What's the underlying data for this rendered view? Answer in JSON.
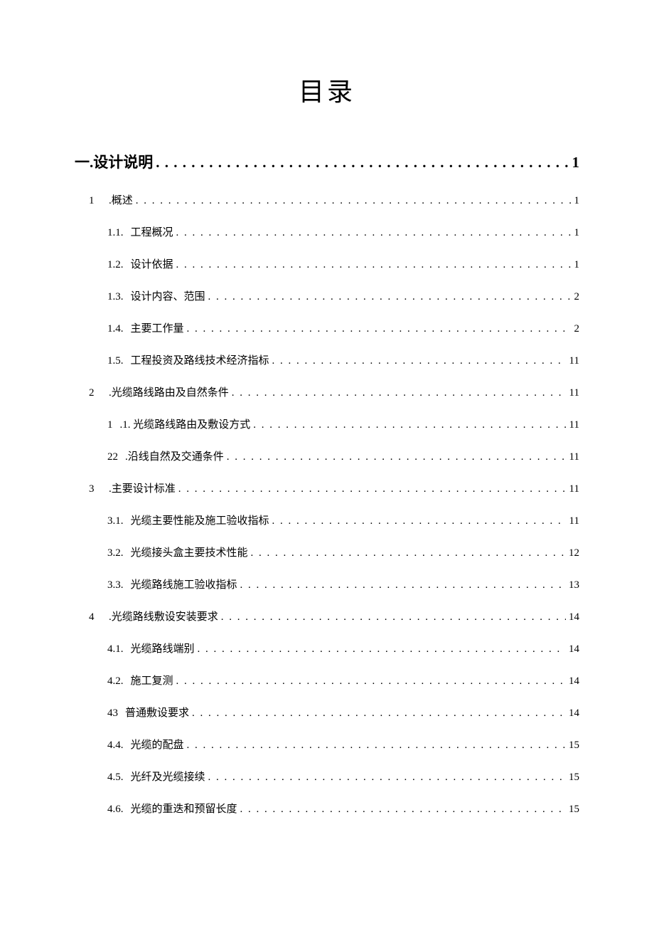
{
  "title": "目录",
  "entries": [
    {
      "level": 1,
      "num": "一.",
      "text": "设计说明",
      "page": "1"
    },
    {
      "level": 2,
      "num": "1",
      "text": ".概述",
      "page": "1"
    },
    {
      "level": 3,
      "num": "1.1.",
      "text": "工程概况",
      "page": "1"
    },
    {
      "level": 3,
      "num": "1.2.",
      "text": "设计依据",
      "page": "1"
    },
    {
      "level": 3,
      "num": "1.3.",
      "text": "设计内容、范围",
      "page": "2"
    },
    {
      "level": 3,
      "num": "1.4.",
      "text": "主要工作量",
      "page": "2"
    },
    {
      "level": 3,
      "num": "1.5.",
      "text": "工程投资及路线技术经济指标",
      "page": "11"
    },
    {
      "level": 2,
      "num": "2",
      "text": ".光缆路线路由及自然条件",
      "page": "11"
    },
    {
      "level": 3,
      "num": "1",
      "text": ".1. 光缆路线路由及敷设方式",
      "page": "11"
    },
    {
      "level": 3,
      "num": "22",
      "text": ".沿线自然及交通条件",
      "page": "11"
    },
    {
      "level": 2,
      "num": "3",
      "text": ".主要设计标准",
      "page": "11"
    },
    {
      "level": 3,
      "num": "3.1.",
      "text": "光缆主要性能及施工验收指标",
      "page": "11"
    },
    {
      "level": 3,
      "num": "3.2.",
      "text": "光缆接头盒主要技术性能",
      "page": "12"
    },
    {
      "level": 3,
      "num": "3.3.",
      "text": "光缆路线施工验收指标",
      "page": "13"
    },
    {
      "level": 2,
      "num": "4",
      "text": ".光缆路线敷设安装要求",
      "page": "14"
    },
    {
      "level": 3,
      "num": "4.1.",
      "text": "光缆路线端别",
      "page": "14"
    },
    {
      "level": 3,
      "num": "4.2.",
      "text": "施工复测",
      "page": "14"
    },
    {
      "level": 3,
      "num": "43",
      "text": "普通敷设要求",
      "page": "14"
    },
    {
      "level": 3,
      "num": "4.4.",
      "text": "光缆的配盘",
      "page": "15"
    },
    {
      "level": 3,
      "num": "4.5.",
      "text": "光纤及光缆接续",
      "page": "15"
    },
    {
      "level": 3,
      "num": "4.6.",
      "text": "光缆的重迭和预留长度",
      "page": "15"
    }
  ]
}
